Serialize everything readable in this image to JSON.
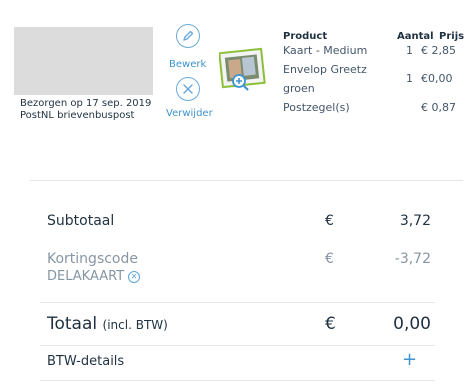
{
  "order_item": {
    "delivery_date": "Bezorgen op 17 sep. 2019",
    "delivery_method": "PostNL brievenbuspost",
    "edit_label": "Bewerk",
    "remove_label": "Verwijder",
    "table": {
      "headers": [
        "Product",
        "Aantal",
        "Prijs"
      ],
      "rows": [
        {
          "product": "Kaart - Medium",
          "qty": "1",
          "price": "€ 2,85"
        },
        {
          "product_line1": "Envelop Greetz",
          "product_line2": "groen",
          "qty": "1",
          "price": "€0,00"
        },
        {
          "product": "Postzegel(s)",
          "qty": "",
          "price": "€ 0,87"
        }
      ]
    }
  },
  "summary": {
    "subtotal_label": "Subtotaal",
    "subtotal_currency": "€",
    "subtotal_value": "3,72",
    "discount_label": "Kortingscode",
    "discount_code": "DELAKAART",
    "discount_currency": "€",
    "discount_value": "-3,72",
    "total_label": "Totaal",
    "total_suffix": "(incl. BTW)",
    "total_currency": "€",
    "total_value": "0,00",
    "vat_details_label": "BTW-details",
    "vat_toggle": "+"
  },
  "colors": {
    "accent": "#3f93cf",
    "text": "#1f3140",
    "muted": "#8796a3"
  },
  "icons": [
    "pencil-icon",
    "close-icon",
    "zoom-in-icon",
    "remove-code-icon",
    "plus-icon"
  ]
}
